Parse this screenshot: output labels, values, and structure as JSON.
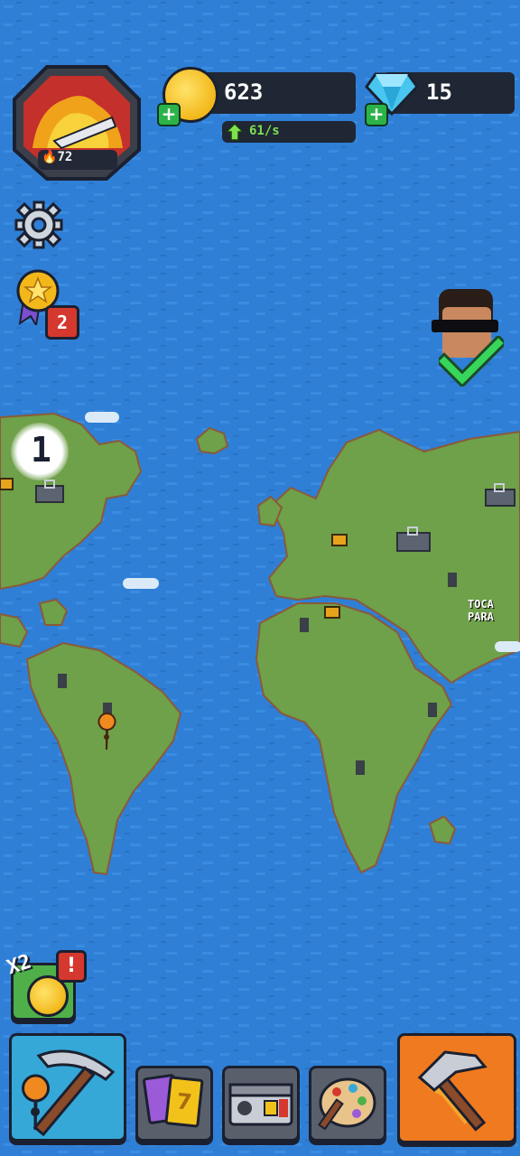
{
  "hud": {
    "power_value": "72",
    "coins": "623",
    "coin_rate": "61/s",
    "gems": "15",
    "achievement_badge": "2"
  },
  "map": {
    "location_level": "1",
    "location_label": "TOCA PARA"
  },
  "bottom_bar": {
    "boost_label": "X2",
    "boost_alert": "!",
    "cards_label": "7"
  },
  "colors": {
    "ocean": "#2f7fd6",
    "land": "#6fa04a",
    "coin_panel": "#1f2735",
    "rate_green": "#7ee04f",
    "hammer_button": "#f07a1f",
    "pickaxe_button": "#35a8d8"
  },
  "icons": [
    "speedometer-fire-icon",
    "coin-icon",
    "diamond-icon",
    "gear-icon",
    "medal-icon",
    "pickaxe-icon",
    "cards-icon",
    "chest-icon",
    "palette-icon",
    "hammer-icon"
  ]
}
